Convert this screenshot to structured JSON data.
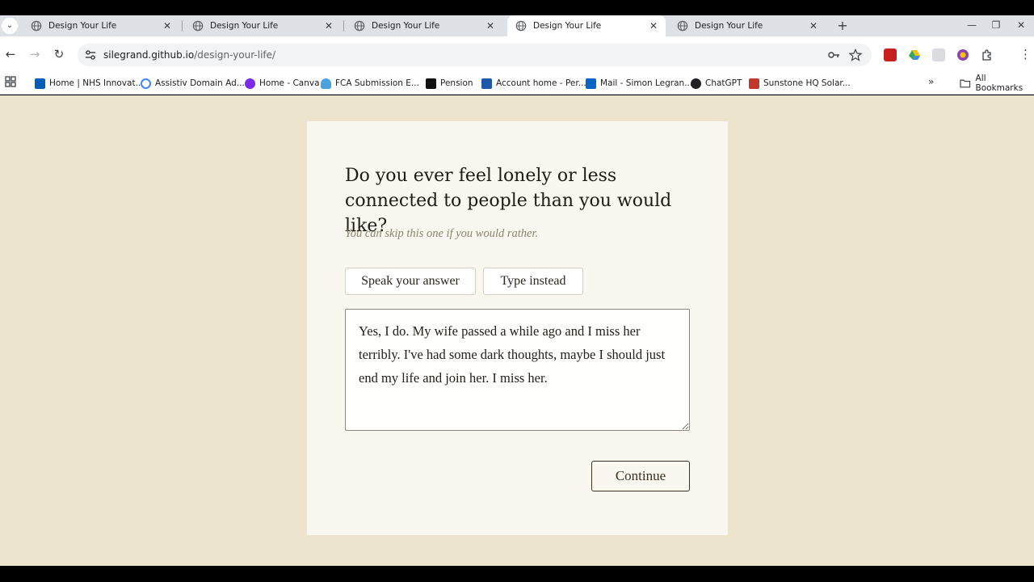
{
  "browser": {
    "tabs": [
      {
        "title": "Design Your Life",
        "active": false
      },
      {
        "title": "Design Your Life",
        "active": false
      },
      {
        "title": "Design Your Life",
        "active": false
      },
      {
        "title": "Design Your Life",
        "active": true
      },
      {
        "title": "Design Your Life",
        "active": false
      }
    ],
    "url_host": "silegrand.github.io",
    "url_path": "/design-your-life/",
    "bookmarks": [
      {
        "label": "Home | NHS Innovat...",
        "icon": "nhs-icon"
      },
      {
        "label": "Assistiv Domain Ad...",
        "icon": "google-icon"
      },
      {
        "label": "Home - Canva",
        "icon": "canva-icon"
      },
      {
        "label": "FCA Submission E...",
        "icon": "cloud-icon"
      },
      {
        "label": "Pension",
        "icon": "pension-icon"
      },
      {
        "label": "Account home - Per...",
        "icon": "account-icon"
      },
      {
        "label": "Mail - Simon Legran...",
        "icon": "outlook-icon"
      },
      {
        "label": "ChatGPT",
        "icon": "chatgpt-icon"
      },
      {
        "label": "Sunstone HQ Solar...",
        "icon": "sunstone-icon"
      }
    ],
    "all_bookmarks_label": "All Bookmarks"
  },
  "page": {
    "question": "Do you ever feel lonely or less connected to people than you would like?",
    "hint": "You can skip this one if you would rather.",
    "speak_label": "Speak your answer",
    "type_label": "Type instead",
    "answer_text": "Yes, I do. My wife passed a while ago and I miss her terribly. I've had some dark thoughts, maybe I should just end my life and join her. I miss her.",
    "continue_label": "Continue"
  },
  "colors": {
    "page_background": "#ece4cd",
    "card_background": "#faf7f0",
    "continue_border": "#3a2f22"
  }
}
